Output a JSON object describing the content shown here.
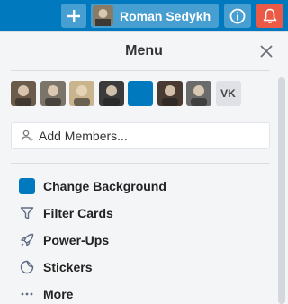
{
  "topbar": {
    "user_name": "Roman Sedykh",
    "colors": {
      "bar": "#0079bf",
      "notification": "#eb5a46"
    }
  },
  "menu": {
    "title": "Menu",
    "members": [
      {
        "name": "member-1",
        "color": "#6b5b4b"
      },
      {
        "name": "member-2",
        "color": "#7b7468"
      },
      {
        "name": "member-3",
        "color": "#c9b48e"
      },
      {
        "name": "member-4",
        "color": "#3b3b3b"
      },
      {
        "name": "member-5",
        "color": "#0079bf"
      },
      {
        "name": "member-6",
        "color": "#4a3b32"
      },
      {
        "name": "member-7",
        "color": "#6b6b6b"
      }
    ],
    "vk_initials": "VK",
    "add_members_label": "Add Members...",
    "items": [
      {
        "label": "Change Background",
        "icon": "background-swatch-icon"
      },
      {
        "label": "Filter Cards",
        "icon": "filter-icon"
      },
      {
        "label": "Power-Ups",
        "icon": "rocket-icon"
      },
      {
        "label": "Stickers",
        "icon": "sticker-icon"
      },
      {
        "label": "More",
        "icon": "more-dots-icon"
      }
    ],
    "background_color": "#0079bf"
  }
}
